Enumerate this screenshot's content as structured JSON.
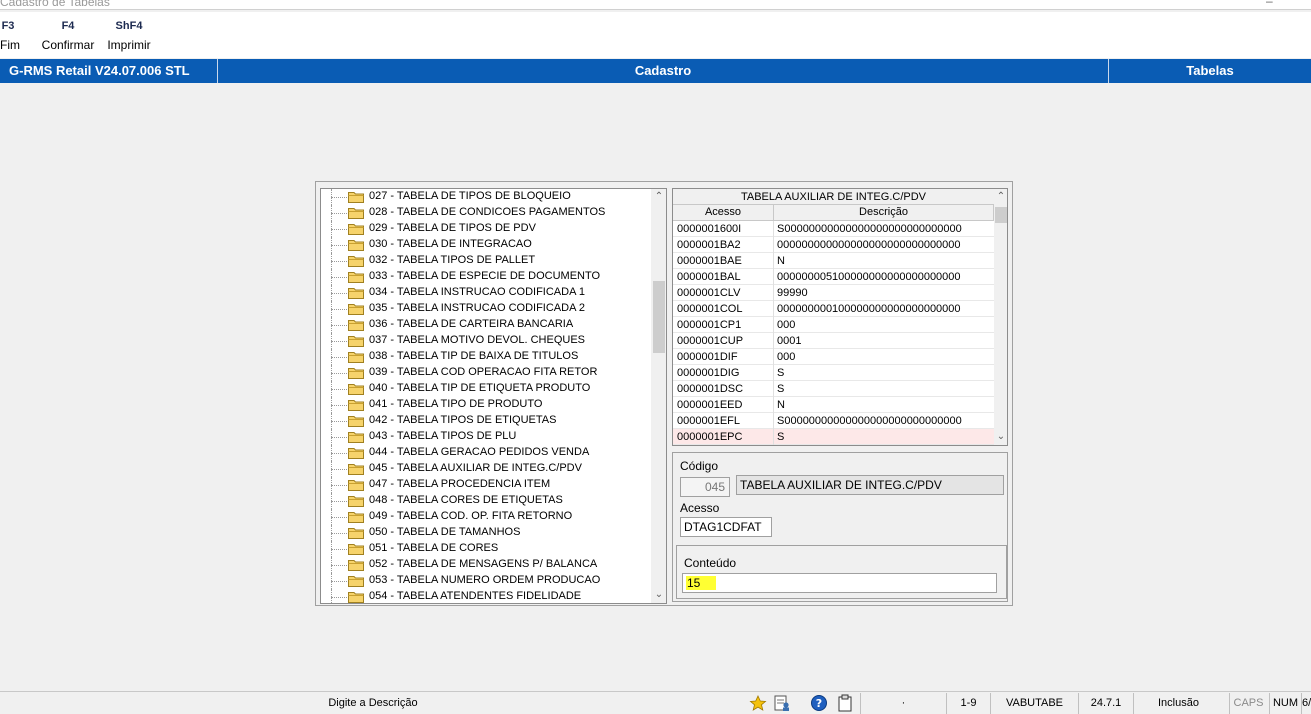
{
  "window": {
    "title": "Cadastro de Tabelas"
  },
  "fkeys": [
    {
      "key": "F3",
      "label": "Fim"
    },
    {
      "key": "F4",
      "label": "Confirmar"
    },
    {
      "key": "ShF4",
      "label": "Imprimir"
    }
  ],
  "header": {
    "app": "G-RMS Retail V24.07.006 STL",
    "module": "Cadastro",
    "section": "Tabelas"
  },
  "tree": {
    "items": [
      "027 - TABELA DE TIPOS DE BLOQUEIO",
      "028 - TABELA DE CONDICOES PAGAMENTOS",
      "029 - TABELA DE TIPOS DE PDV",
      "030 - TABELA DE INTEGRACAO",
      "032 - TABELA TIPOS DE PALLET",
      "033 - TABELA DE ESPECIE DE DOCUMENTO",
      "034 - TABELA INSTRUCAO CODIFICADA 1",
      "035 - TABELA INSTRUCAO CODIFICADA 2",
      "036 - TABELA DE CARTEIRA BANCARIA",
      "037 - TABELA MOTIVO DEVOL. CHEQUES",
      "038 - TABELA TIP DE BAIXA DE TITULOS",
      "039 - TABELA COD OPERACAO FITA RETOR",
      "040 - TABELA TIP DE ETIQUETA PRODUTO",
      "041 - TABELA TIPO DE PRODUTO",
      "042 - TABELA TIPOS DE ETIQUETAS",
      "043 - TABELA TIPOS DE PLU",
      "044 - TABELA GERACAO PEDIDOS VENDA",
      "045 - TABELA AUXILIAR DE INTEG.C/PDV",
      "047 - TABELA PROCEDENCIA ITEM",
      "048 - TABELA CORES DE ETIQUETAS",
      "049 - TABELA COD. OP. FITA RETORNO",
      "050 - TABELA DE TAMANHOS",
      "051 - TABELA DE CORES",
      "052 - TABELA DE MENSAGENS P/ BALANCA",
      "053 - TABELA NUMERO ORDEM  PRODUCAO",
      "054 - TABELA ATENDENTES FIDELIDADE"
    ]
  },
  "grid": {
    "caption": "TABELA AUXILIAR DE INTEG.C/PDV",
    "columns": [
      "Acesso",
      "Descrição"
    ],
    "rows": [
      [
        "0000001600I",
        "S00000000000000000000000000000"
      ],
      [
        "0000001BA2",
        "000000000000000000000000000000"
      ],
      [
        "0000001BAE",
        "N"
      ],
      [
        "0000001BAL",
        "000000005100000000000000000000"
      ],
      [
        "0000001CLV",
        "99990"
      ],
      [
        "0000001COL",
        "000000000100000000000000000000"
      ],
      [
        "0000001CP1",
        "000"
      ],
      [
        "0000001CUP",
        "0001"
      ],
      [
        "0000001DIF",
        "000"
      ],
      [
        "0000001DIG",
        "S"
      ],
      [
        "0000001DSC",
        "S"
      ],
      [
        "0000001EED",
        "N"
      ],
      [
        "0000001EFL",
        "S00000000000000000000000000000"
      ],
      [
        "0000001EPC",
        "S"
      ]
    ],
    "selected_row": 13
  },
  "form": {
    "codigo_label": "Código",
    "codigo_value": "045",
    "codigo_desc": "TABELA AUXILIAR DE INTEG.C/PDV",
    "acesso_label": "Acesso",
    "acesso_value": "DTAG1CDFAT",
    "conteudo_label": "Conteúdo",
    "conteudo_value": "15"
  },
  "status": {
    "message": "Digite a Descrição",
    "dot": "·",
    "page": "1-9",
    "program": "VABUTABE",
    "version": "24.7.1",
    "mode": "Inclusão",
    "caps": "CAPS",
    "num": "NUM",
    "extra": "6/"
  },
  "colors": {
    "header_blue": "#0a5cb4",
    "highlight": "#ffff33",
    "selected_row": "#fde8e8",
    "folder": "#f6d36b"
  }
}
